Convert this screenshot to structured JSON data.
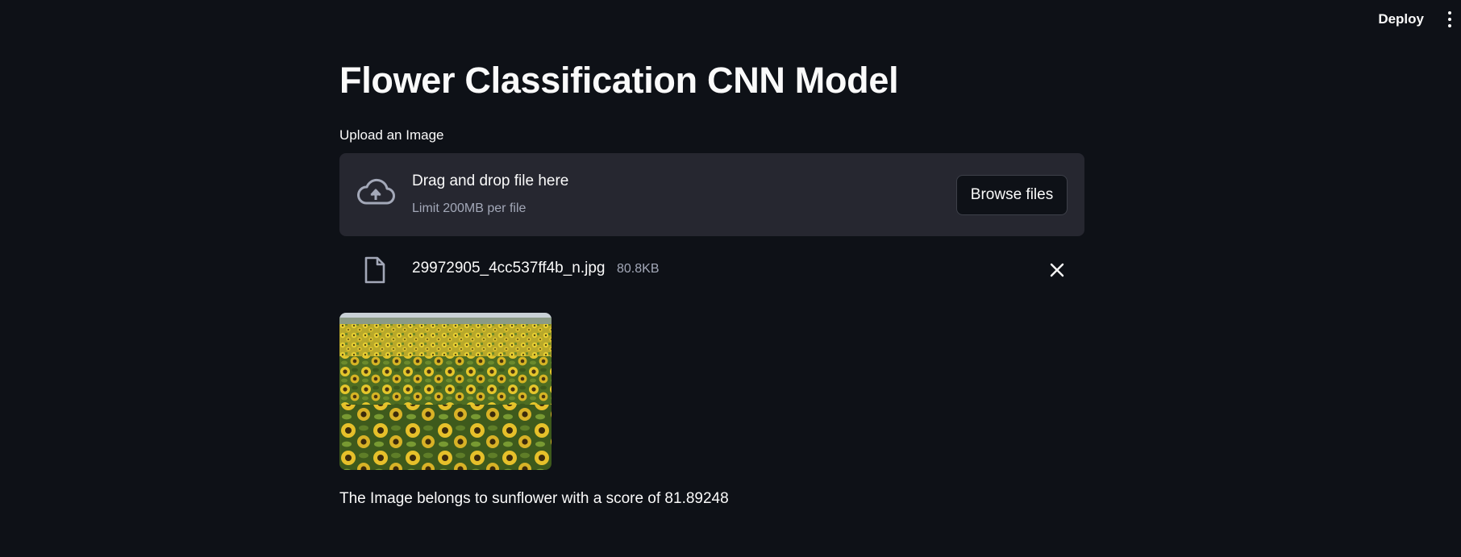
{
  "header": {
    "deploy_label": "Deploy",
    "menu_icon": "kebab-menu-icon"
  },
  "main": {
    "title": "Flower Classification CNN Model",
    "uploader": {
      "label": "Upload an Image",
      "drop_text": "Drag and drop file here",
      "limit_text": "Limit 200MB per file",
      "browse_label": "Browse files",
      "icon": "cloud-upload-icon"
    },
    "uploaded_file": {
      "name": "29972905_4cc537ff4b_n.jpg",
      "size": "80.8KB",
      "icon": "file-icon",
      "remove_icon": "close-icon"
    },
    "result_text": "The Image belongs to sunflower with a score of 81.89248"
  },
  "colors": {
    "background": "#0e1117",
    "dropzone": "#262730",
    "text": "#fafafa",
    "muted": "#a3a8b8"
  }
}
